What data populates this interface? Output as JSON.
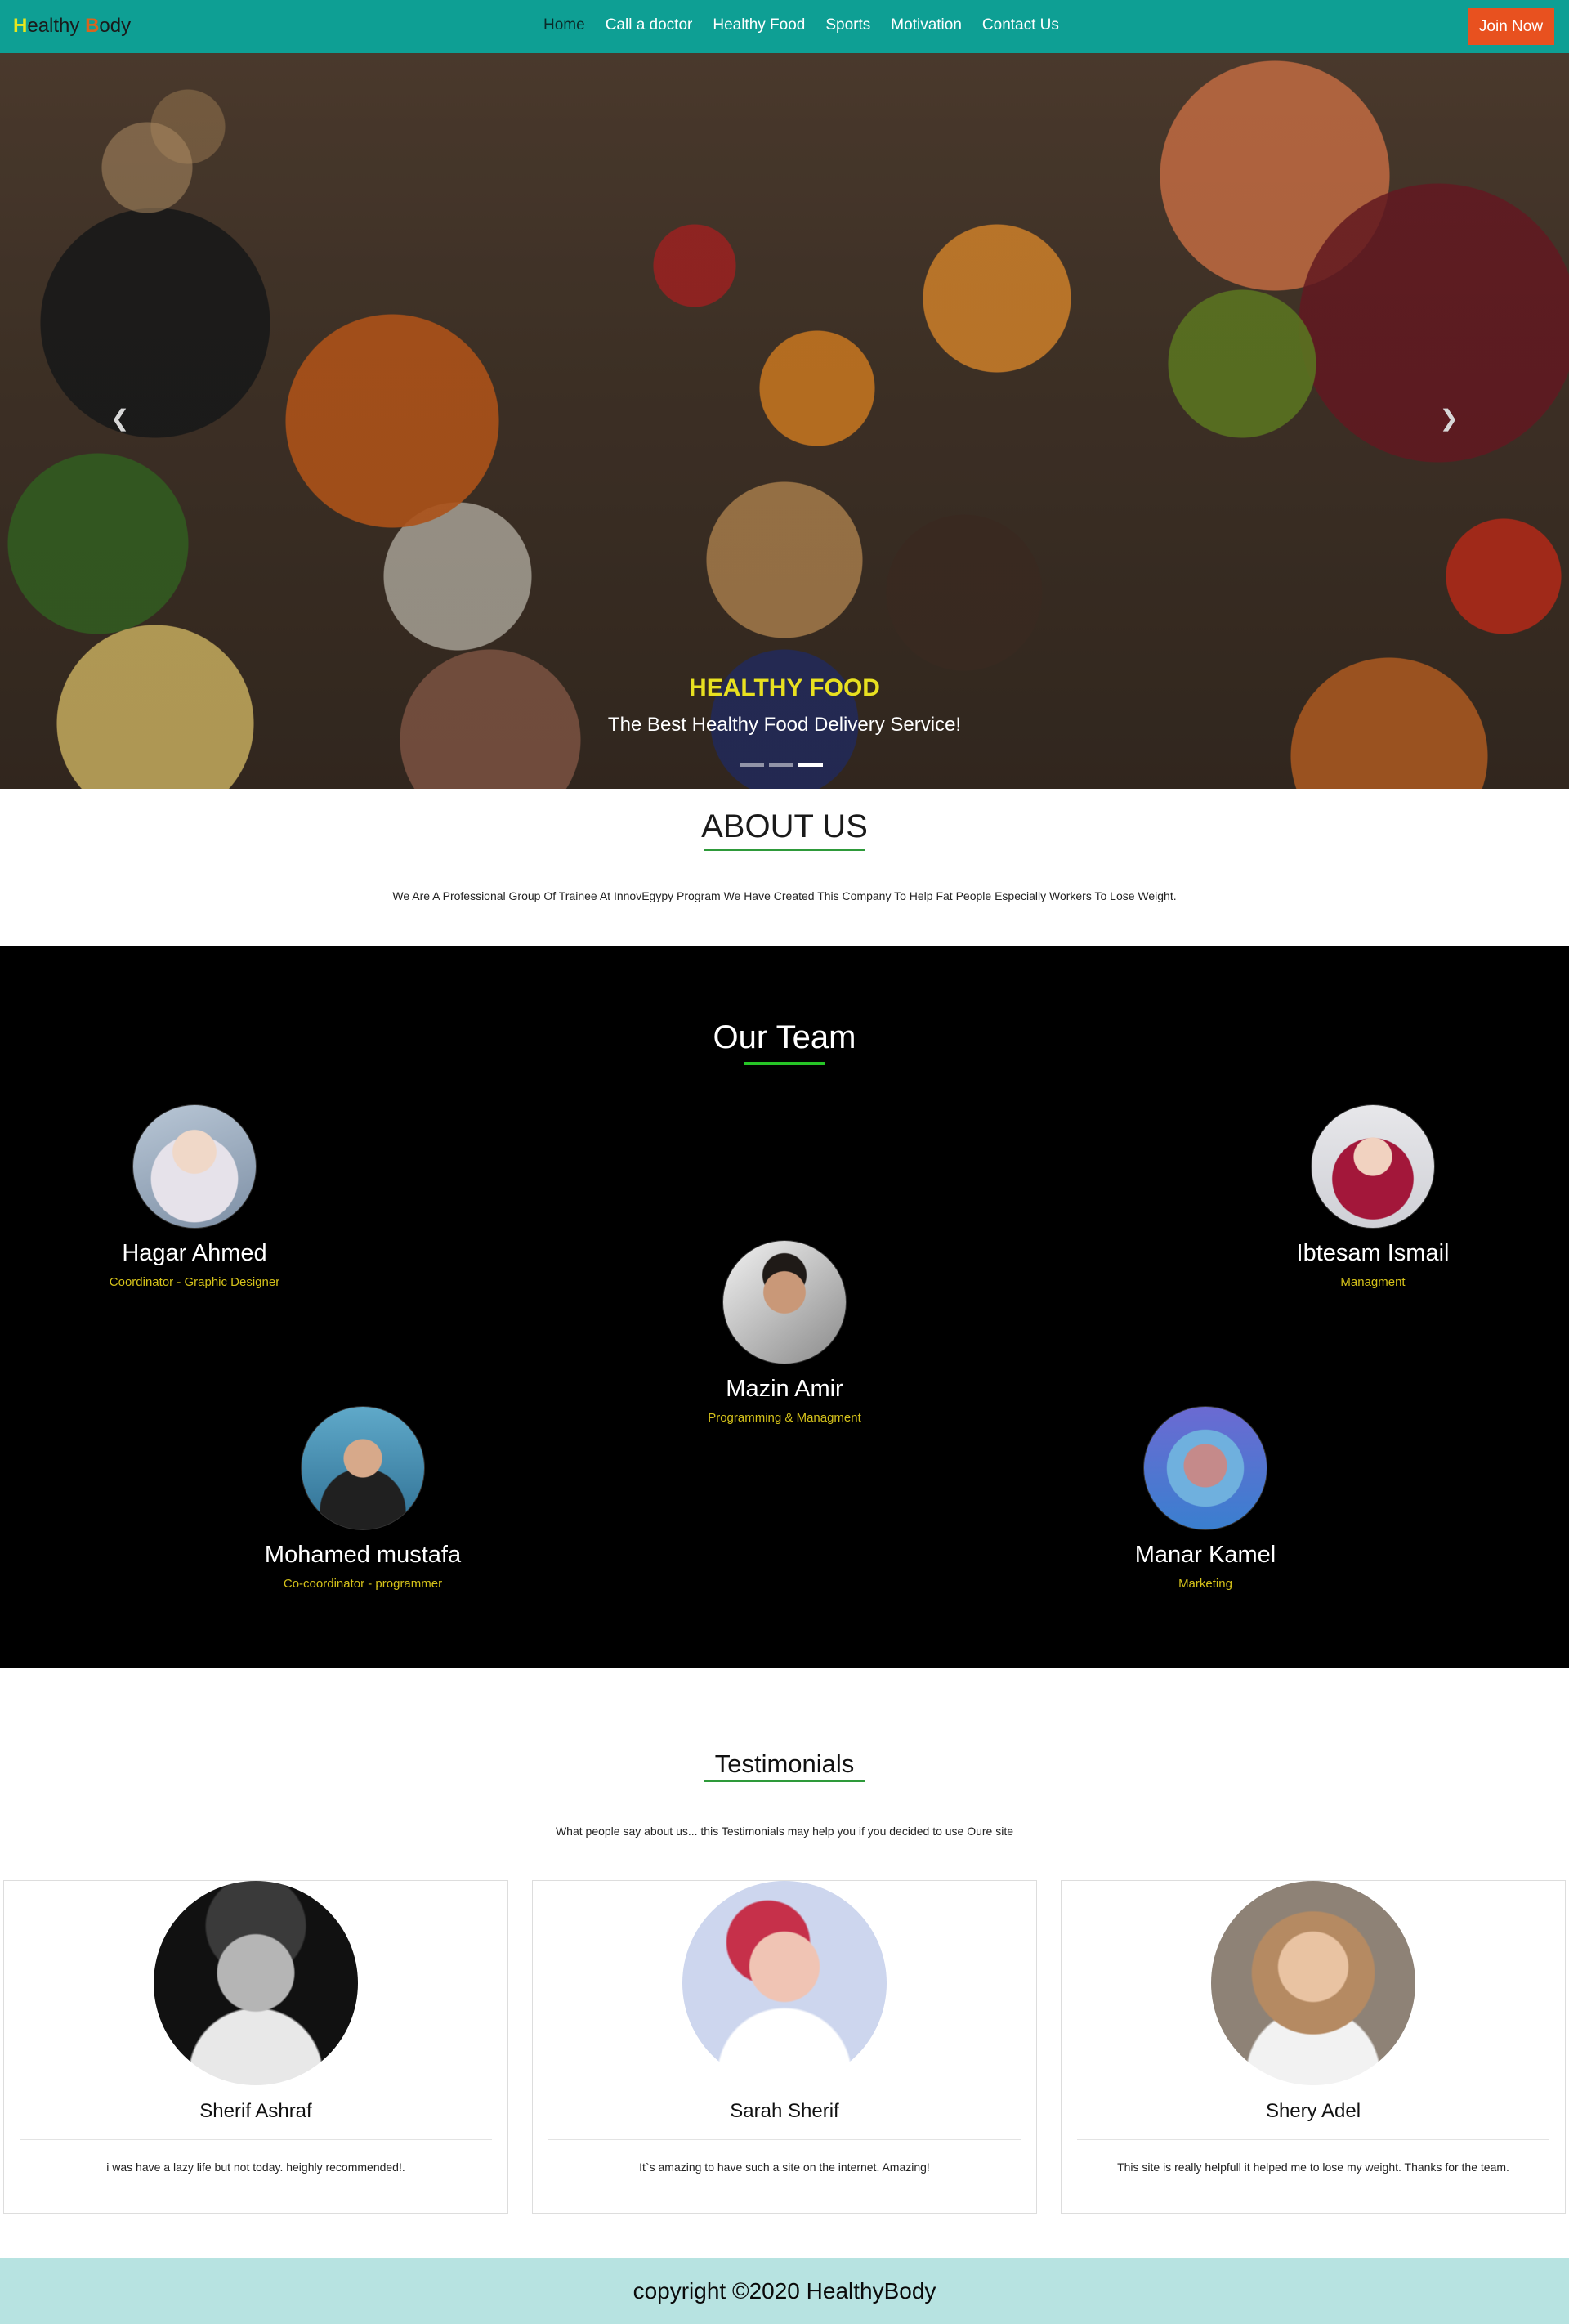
{
  "brand": {
    "first_letter": "H",
    "first_rest": "ealthy ",
    "second_letter": "B",
    "second_rest": "ody"
  },
  "nav": {
    "items": [
      "Home",
      "Call a doctor",
      "Healthy Food",
      "Sports",
      "Motivation",
      "Contact Us"
    ],
    "active": "Home",
    "join_label": "Join Now"
  },
  "hero": {
    "title": "HEALTHY FOOD",
    "subtitle": "The Best Healthy Food Delivery Service!",
    "prev_icon": "chevron-left-icon",
    "next_icon": "chevron-right-icon",
    "slides": 3,
    "active_slide": 3
  },
  "about": {
    "title": "ABOUT US",
    "text": "We Are A Professional Group Of Trainee At InnovEgypy Program We Have Created This Company To Help Fat People Especially Workers To Lose Weight."
  },
  "team": {
    "title": "Our Team",
    "members": [
      {
        "name": "Hagar Ahmed",
        "role": "Coordinator - Graphic Designer"
      },
      {
        "name": "Ibtesam Ismail",
        "role": "Managment"
      },
      {
        "name": "Mazin Amir",
        "role": "Programming & Managment"
      },
      {
        "name": "Mohamed mustafa",
        "role": "Co-coordinator - programmer"
      },
      {
        "name": "Manar Kamel",
        "role": "Marketing"
      }
    ]
  },
  "testimonials": {
    "title": "Testimonials",
    "lead": "What people say about us... this Testimonials may help you if you decided to use Oure site",
    "items": [
      {
        "name": "Sherif Ashraf",
        "quote": "i was have a lazy life but not today. heighly recommended!."
      },
      {
        "name": "Sarah Sherif",
        "quote": "It`s amazing to have such a site on the internet. Amazing!"
      },
      {
        "name": "Shery Adel",
        "quote": "This site is really helpfull it helped me to lose my weight. Thanks for the team."
      }
    ]
  },
  "footer": {
    "text": "copyright ©2020 HealthyBody"
  },
  "colors": {
    "nav_bg": "#0e9f94",
    "join_bg": "#e8511f",
    "hero_title": "#e8e020",
    "role": "#d4c11a",
    "underline": "#2e9a3a",
    "footer_bg": "#b7e3e1"
  }
}
